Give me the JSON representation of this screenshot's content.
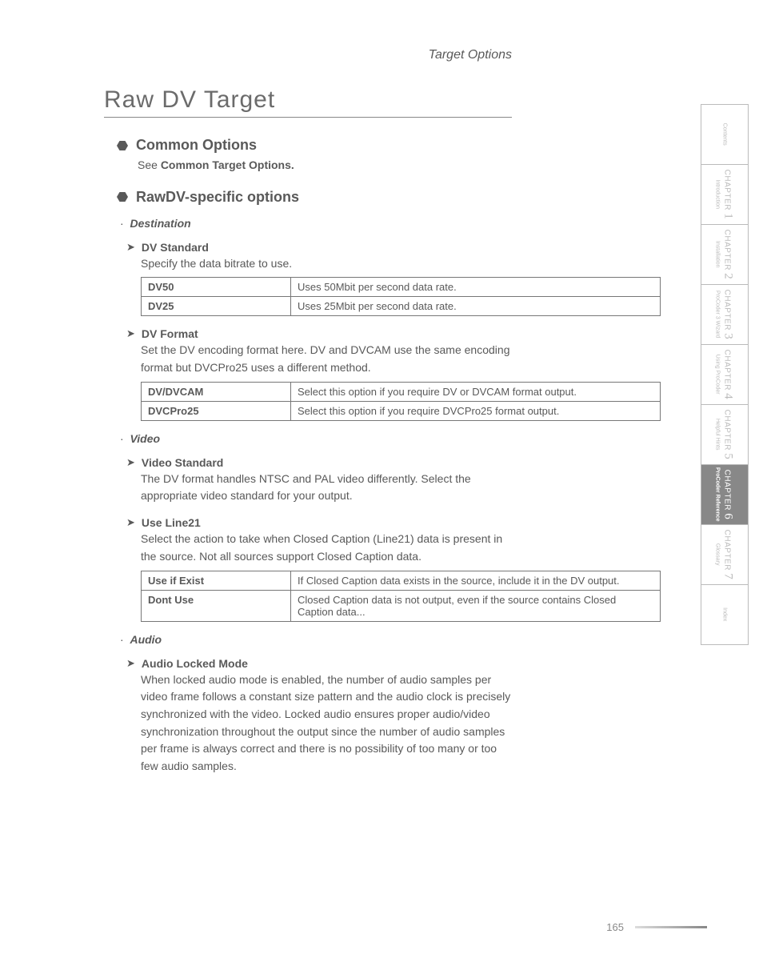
{
  "header": {
    "section": "Target Options"
  },
  "title": "Raw DV Target",
  "common": {
    "heading": "Common Options",
    "see_prefix": "See ",
    "see_bold": "Common Target Options."
  },
  "rawdv": {
    "heading": "RawDV-specific options"
  },
  "destination": {
    "label": "Destination",
    "dv_standard": {
      "heading": "DV Standard",
      "desc": "Specify the data bitrate to use.",
      "rows": [
        {
          "k": "DV50",
          "v": "Uses 50Mbit per second data rate."
        },
        {
          "k": "DV25",
          "v": "Uses 25Mbit per second data rate."
        }
      ]
    },
    "dv_format": {
      "heading": "DV Format",
      "desc": "Set the DV encoding format here. DV and DVCAM use the same encoding format but DVCPro25 uses a different method.",
      "rows": [
        {
          "k": "DV/DVCAM",
          "v": "Select this option if you require DV or DVCAM format output."
        },
        {
          "k": "DVCPro25",
          "v": "Select this option if you require DVCPro25 format output."
        }
      ]
    }
  },
  "video": {
    "label": "Video",
    "video_standard": {
      "heading": "Video Standard",
      "desc": "The DV format handles NTSC and PAL video differently. Select the appropriate video standard for your output."
    },
    "use_line21": {
      "heading": "Use Line21",
      "desc": "Select the action to take when Closed Caption (Line21) data is present in the source. Not all sources support Closed Caption data.",
      "rows": [
        {
          "k": "Use if Exist",
          "v": "If Closed Caption data exists in the source, include it in the DV output."
        },
        {
          "k": "Dont Use",
          "v": "Closed Caption data is not output, even if the source contains Closed Caption data..."
        }
      ]
    }
  },
  "audio": {
    "label": "Audio",
    "locked": {
      "heading": "Audio Locked Mode",
      "desc": "When locked audio mode is enabled, the number of audio samples per video frame follows a constant size pattern and the audio clock is precisely synchronized with the video. Locked audio ensures proper audio/video synchronization throughout the output since the number of audio samples per frame is always correct and there is no possibility of too many or too few audio samples."
    }
  },
  "footer": {
    "page": "165"
  },
  "tabs": [
    {
      "chapter": "",
      "num": "",
      "sub": "Contents",
      "active": false
    },
    {
      "chapter": "CHAPTER",
      "num": "1",
      "sub": "Introduction",
      "active": false
    },
    {
      "chapter": "CHAPTER",
      "num": "2",
      "sub": "Installation",
      "active": false
    },
    {
      "chapter": "CHAPTER",
      "num": "3",
      "sub": "ProCoder 3 Wizard",
      "active": false
    },
    {
      "chapter": "CHAPTER",
      "num": "4",
      "sub": "Using ProCoder",
      "active": false
    },
    {
      "chapter": "CHAPTER",
      "num": "5",
      "sub": "Helpful Hints",
      "active": false
    },
    {
      "chapter": "CHAPTER",
      "num": "6",
      "sub": "ProCoder Reference",
      "active": true
    },
    {
      "chapter": "CHAPTER",
      "num": "7",
      "sub": "Glossary",
      "active": false
    },
    {
      "chapter": "",
      "num": "",
      "sub": "Index",
      "active": false
    }
  ]
}
